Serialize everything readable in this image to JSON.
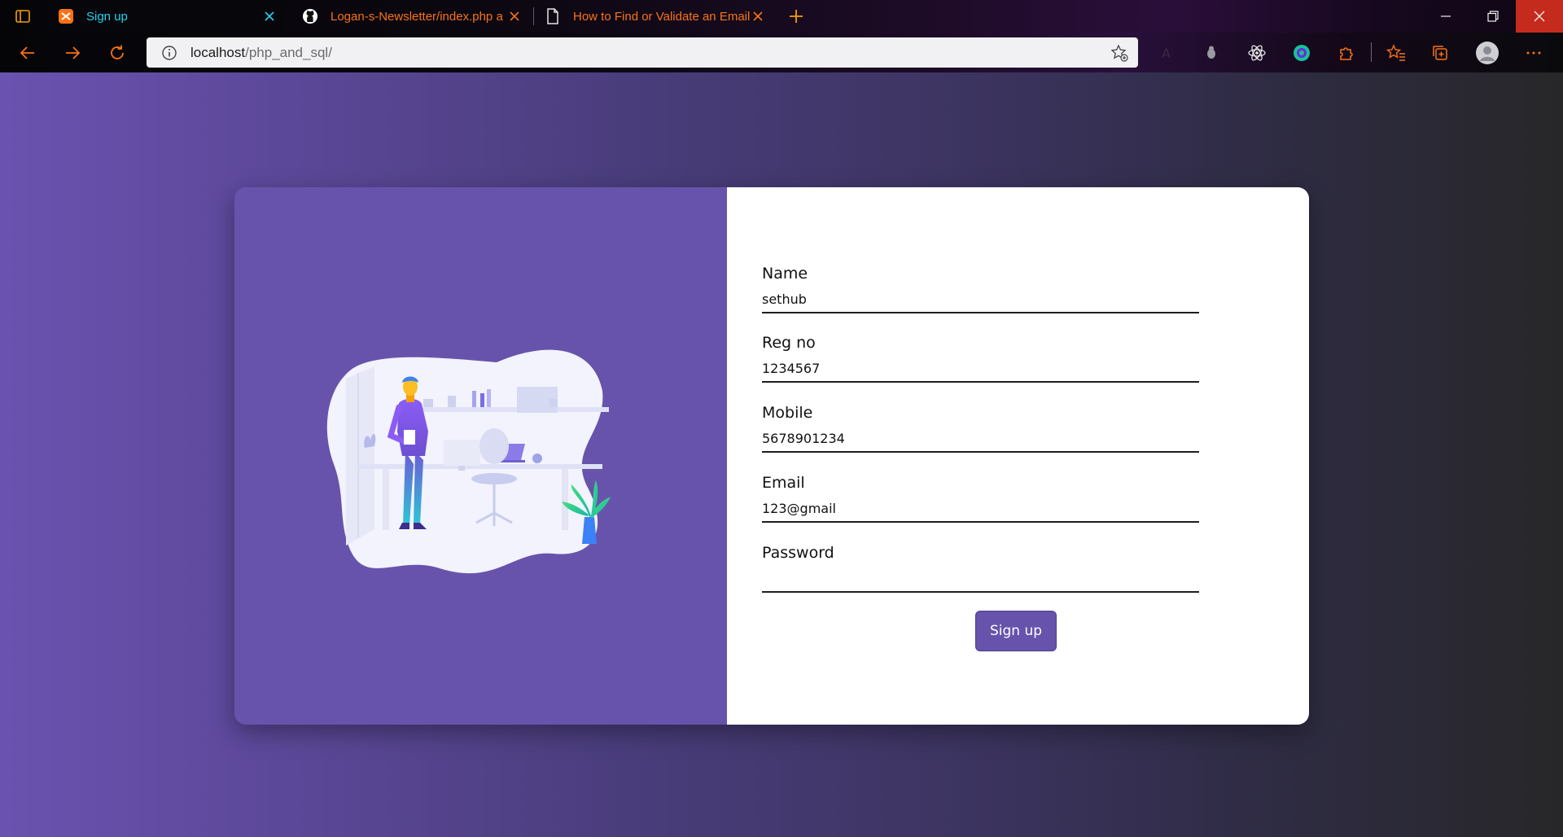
{
  "browser": {
    "tabs": [
      {
        "label": "Sign up",
        "icon": "xampp-icon",
        "active": true
      },
      {
        "label": "Logan-s-Newsletter/index.php a",
        "icon": "github-icon",
        "active": false
      },
      {
        "label": "How to Find or Validate an Email",
        "icon": "page-icon",
        "active": false
      }
    ],
    "address": {
      "host": "localhost",
      "path": "/php_and_sql/"
    },
    "colors": {
      "active_tab_text": "#22d3ee",
      "inactive_tab_text": "#f97316",
      "close_button": "#c42b1c"
    }
  },
  "page": {
    "colors": {
      "accent": "#6753ab",
      "background_start": "#6a52b0",
      "background_end": "#272729"
    },
    "form": {
      "fields": [
        {
          "label": "Name",
          "value": "sethub",
          "type": "text"
        },
        {
          "label": "Reg no",
          "value": "1234567",
          "type": "text"
        },
        {
          "label": "Mobile",
          "value": "5678901234",
          "type": "text"
        },
        {
          "label": "Email",
          "value": "123@gmail",
          "type": "text"
        },
        {
          "label": "Password",
          "value": "",
          "type": "password"
        }
      ],
      "submit_label": "Sign up"
    },
    "illustration": "person-at-desk-illustration"
  }
}
